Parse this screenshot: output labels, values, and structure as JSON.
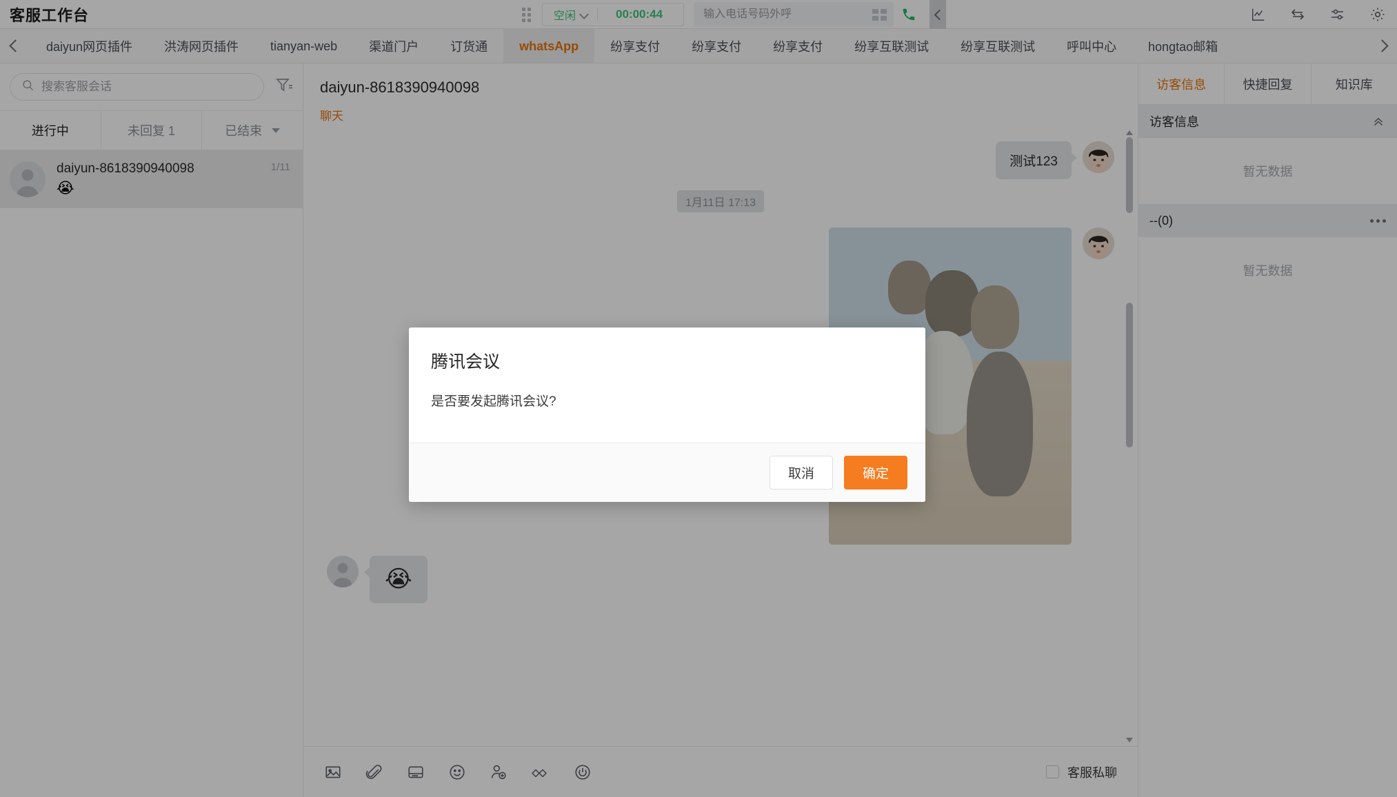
{
  "app": {
    "title": "客服工作台"
  },
  "topbar": {
    "drag_handle": "drag-handle",
    "status": {
      "label": "空闲",
      "color": "#3ec57a"
    },
    "timer": "00:00:44",
    "phone": {
      "value": "",
      "placeholder": "输入电话号码外呼"
    },
    "keypad_icon": "keypad-icon",
    "call_icon": "phone-call-icon",
    "collapse_icon": "chevron-left-icon",
    "right_icons": [
      {
        "name": "statistics-icon",
        "label": "统计"
      },
      {
        "name": "transfer-icon",
        "label": "转接"
      },
      {
        "name": "sliders-icon",
        "label": "设置项"
      },
      {
        "name": "gear-icon",
        "label": "系统设置"
      }
    ]
  },
  "tabstrip": {
    "prev_label": "上一页",
    "next_label": "下一页",
    "tabs": [
      {
        "label": "daiyun网页插件",
        "active": false
      },
      {
        "label": "洪涛网页插件",
        "active": false
      },
      {
        "label": "tianyan-web",
        "active": false
      },
      {
        "label": "渠道门户",
        "active": false
      },
      {
        "label": "订货通",
        "active": false
      },
      {
        "label": "whatsApp",
        "active": true
      },
      {
        "label": "纷享支付",
        "active": false
      },
      {
        "label": "纷享支付",
        "active": false
      },
      {
        "label": "纷享支付",
        "active": false
      },
      {
        "label": "纷享互联测试",
        "active": false
      },
      {
        "label": "纷享互联测试",
        "active": false
      },
      {
        "label": "呼叫中心",
        "active": false
      },
      {
        "label": "hongtao邮箱",
        "active": false
      }
    ],
    "active_color": "#e8730c"
  },
  "sidebar": {
    "search": {
      "value": "",
      "placeholder": "搜索客服会话"
    },
    "search_icon": "search-icon",
    "filter_icon": "filter-icon",
    "tabs": [
      {
        "label": "进行中",
        "active": true
      },
      {
        "label": "未回复 1",
        "active": false
      },
      {
        "label": "已结束",
        "active": false
      }
    ],
    "conversations": [
      {
        "name": "daiyun-8618390940098",
        "time": "1/11",
        "preview": "😭",
        "selected": true
      }
    ]
  },
  "chat": {
    "title": "daiyun-8618390940098",
    "subtabs": [
      {
        "label": "聊天",
        "active": true
      }
    ],
    "messages": [
      {
        "type": "text",
        "direction": "out",
        "text": "测试123"
      },
      {
        "type": "divider",
        "text": "1月11日 17:13"
      },
      {
        "type": "image",
        "direction": "out",
        "alt": "猫咪合照"
      },
      {
        "type": "text",
        "direction": "in",
        "text": "😭",
        "emoji_only": true
      }
    ],
    "compose_tools": [
      {
        "name": "image-icon",
        "label": "图片"
      },
      {
        "name": "paperclip-icon",
        "label": "附件"
      },
      {
        "name": "card-icon",
        "label": "名片"
      },
      {
        "name": "emoji-icon",
        "label": "表情"
      },
      {
        "name": "add-user-icon",
        "label": "邀请"
      },
      {
        "name": "tencent-meeting-icon",
        "label": "腾讯会议"
      },
      {
        "name": "end-session-icon",
        "label": "结束会话"
      }
    ],
    "private_chat": {
      "label": "客服私聊",
      "checked": false
    }
  },
  "right_panel": {
    "tabs": [
      {
        "label": "访客信息",
        "active": true
      },
      {
        "label": "快捷回复",
        "active": false
      },
      {
        "label": "知识库",
        "active": false
      }
    ],
    "sections": [
      {
        "title": "访客信息",
        "empty_text": "暂无数据",
        "collapse_icon": "chevron-up-double-icon"
      },
      {
        "title": "--(0)",
        "empty_text": "暂无数据",
        "menu_icon": "more-dots-icon"
      }
    ]
  },
  "modal": {
    "title": "腾讯会议",
    "message": "是否要发起腾讯会议?",
    "cancel_label": "取消",
    "confirm_label": "确定",
    "confirm_color": "#f57c1f"
  }
}
